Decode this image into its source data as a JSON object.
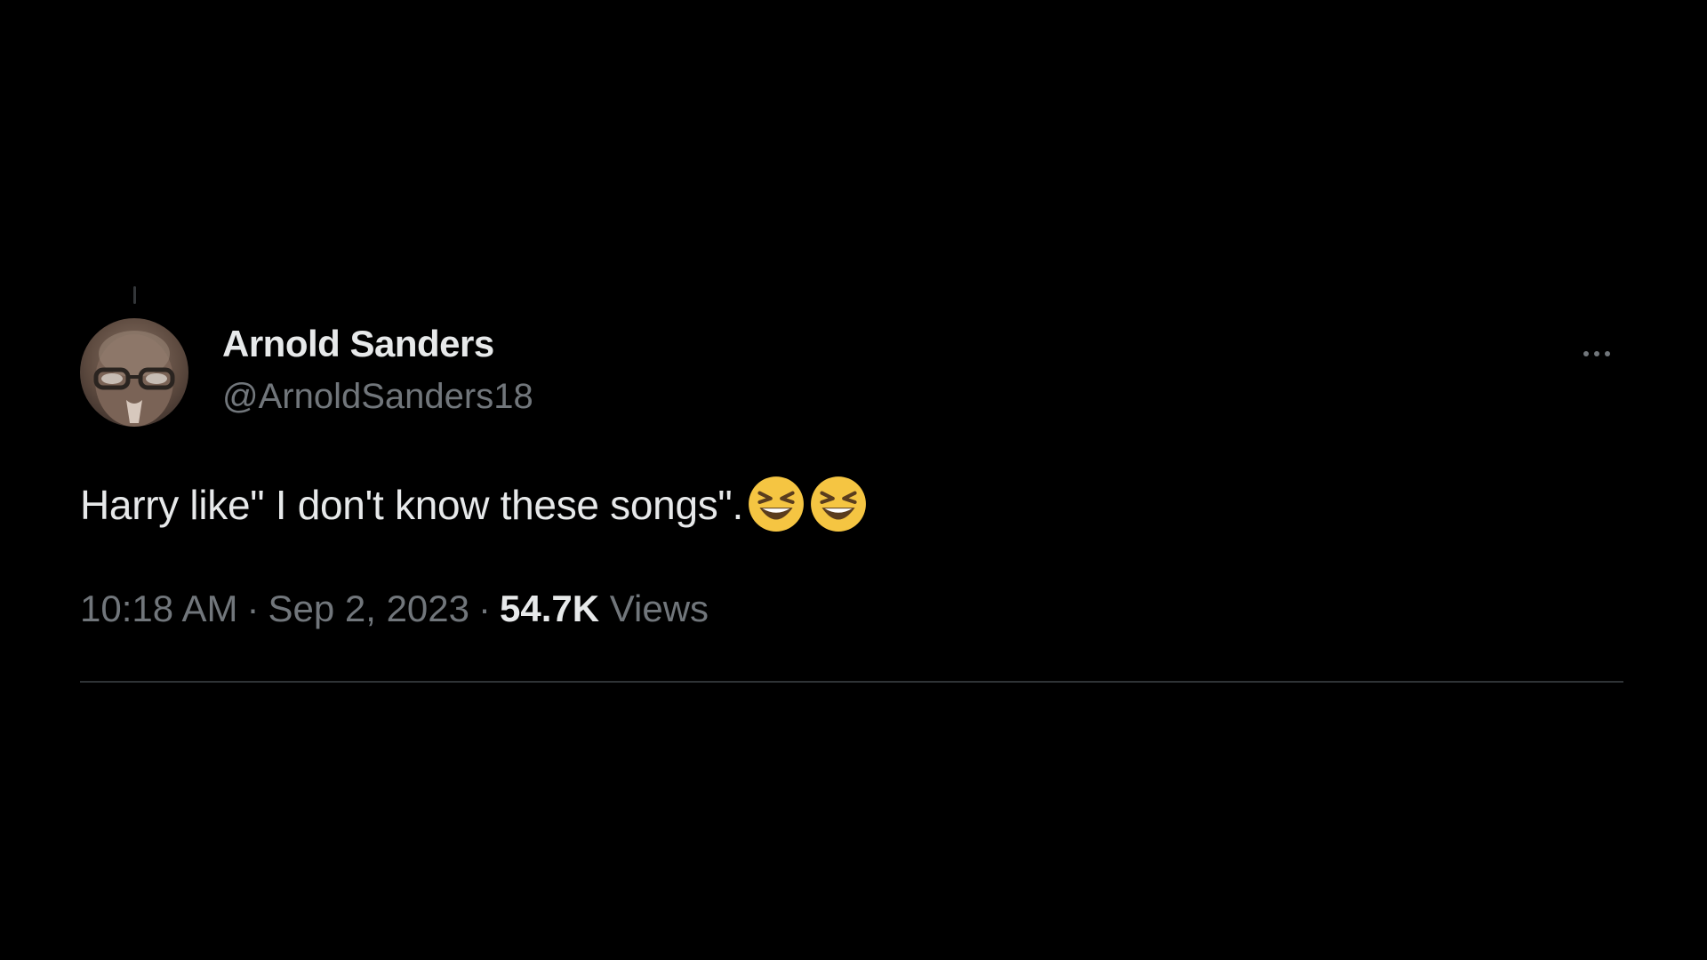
{
  "tweet": {
    "author": {
      "name": "Arnold Sanders",
      "handle": "@ArnoldSanders18"
    },
    "text": "Harry like\" I don't know these songs\".",
    "emojis": [
      "grinning-squinting-face-icon",
      "grinning-squinting-face-icon"
    ],
    "meta": {
      "time": "10:18 AM",
      "separator": "·",
      "date": "Sep 2, 2023",
      "views_count": "54.7K",
      "views_label": "Views"
    }
  },
  "colors": {
    "background": "#000000",
    "primary_text": "#e7e9ea",
    "secondary_text": "#71767b",
    "divider": "#2f3336",
    "emoji_yellow": "#f5c542"
  }
}
